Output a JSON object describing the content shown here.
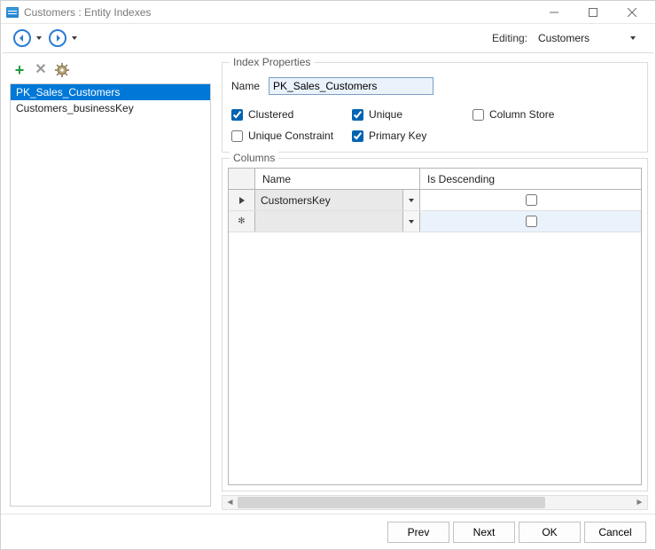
{
  "titlebar": {
    "title": "Customers : Entity Indexes"
  },
  "nav": {
    "editing_label": "Editing:",
    "editing_value": "Customers"
  },
  "toolbar": {
    "add_tooltip": "Add",
    "delete_tooltip": "Delete",
    "options_tooltip": "Options"
  },
  "index_list": [
    {
      "label": "PK_Sales_Customers",
      "selected": true
    },
    {
      "label": "Customers_businessKey",
      "selected": false
    }
  ],
  "index_props": {
    "legend": "Index Properties",
    "name_label": "Name",
    "name_value": "PK_Sales_Customers",
    "chk_clustered": {
      "label": "Clustered",
      "checked": true
    },
    "chk_unique": {
      "label": "Unique",
      "checked": true
    },
    "chk_column_store": {
      "label": "Column Store",
      "checked": false
    },
    "chk_unique_constraint": {
      "label": "Unique Constraint",
      "checked": false
    },
    "chk_primary_key": {
      "label": "Primary Key",
      "checked": true
    }
  },
  "columns_group": {
    "legend": "Columns",
    "col_name_header": "Name",
    "col_desc_header": "Is Descending",
    "rows": [
      {
        "name": "CustomersKey",
        "is_descending": false,
        "current": true
      },
      {
        "name": "",
        "is_descending": false,
        "current": false
      }
    ]
  },
  "footer": {
    "prev": "Prev",
    "next": "Next",
    "ok": "OK",
    "cancel": "Cancel"
  }
}
